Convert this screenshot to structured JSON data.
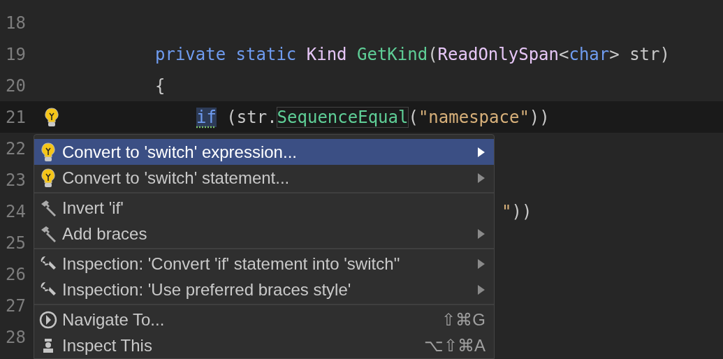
{
  "editor": {
    "lines": [
      {
        "number": "18"
      },
      {
        "number": "19",
        "tokens": [
          {
            "text": "private static ",
            "kind": "keyword"
          },
          {
            "text": "Kind ",
            "kind": "type"
          },
          {
            "text": "GetKind",
            "kind": "method"
          },
          {
            "text": "(",
            "kind": "plain"
          },
          {
            "text": "ReadOnlySpan",
            "kind": "type"
          },
          {
            "text": "<",
            "kind": "plain"
          },
          {
            "text": "char",
            "kind": "keyword"
          },
          {
            "text": "> str)",
            "kind": "plain"
          }
        ]
      },
      {
        "number": "20",
        "tokens": [
          {
            "text": "{",
            "kind": "plain"
          }
        ],
        "children": [
          {
            "number": "21",
            "current": true,
            "bulb": true,
            "tokens": [
              {
                "text": "if",
                "kind": "keyword",
                "highlighted": true,
                "framed": false
              },
              {
                "text": " (str.",
                "kind": "plain",
                "highlighted": false,
                "framed": false
              },
              {
                "text": "SequenceEqual",
                "kind": "method",
                "highlighted": false,
                "framed": true
              },
              {
                "text": "(",
                "kind": "plain",
                "highlighted": false,
                "framed": false
              },
              {
                "text": "\"namespace\"",
                "kind": "string",
                "highlighted": false,
                "framed": false
              },
              {
                "text": "))",
                "kind": "plain",
                "highlighted": false,
                "framed": false
              }
            ]
          }
        ]
      },
      {
        "number": "22"
      },
      {
        "number": "23"
      },
      {
        "number": "24",
        "after_popup": true,
        "tokens": [
          {
            "text": "\"",
            "kind": "string"
          },
          {
            "text": "))",
            "kind": "plain"
          }
        ]
      },
      {
        "number": "25"
      },
      {
        "number": "26"
      },
      {
        "number": "27"
      },
      {
        "number": "28"
      }
    ]
  },
  "popup": {
    "groups": [
      [
        {
          "kind": "intention",
          "label": "Convert to 'switch' expression...",
          "submenu": true,
          "selected": true
        },
        {
          "kind": "intention",
          "label": "Convert to 'switch' statement...",
          "submenu": true,
          "selected": false
        }
      ],
      [
        {
          "kind": "refactor",
          "label": "Invert 'if'",
          "submenu": false,
          "selected": false
        },
        {
          "kind": "refactor",
          "label": "Add braces",
          "submenu": true,
          "selected": false
        }
      ],
      [
        {
          "kind": "inspection",
          "label": "Inspection: 'Convert 'if' statement into 'switch''",
          "submenu": true,
          "selected": false
        },
        {
          "kind": "inspection",
          "label": "Inspection: 'Use preferred braces style'",
          "submenu": true,
          "selected": false
        }
      ],
      [
        {
          "kind": "navigate",
          "label": "Navigate To...",
          "shortcut": "⇧⌘G",
          "submenu": false,
          "selected": false
        },
        {
          "kind": "inspect",
          "label": "Inspect This",
          "shortcut": "⌥⇧⌘A",
          "submenu": false,
          "selected": false
        }
      ]
    ]
  }
}
